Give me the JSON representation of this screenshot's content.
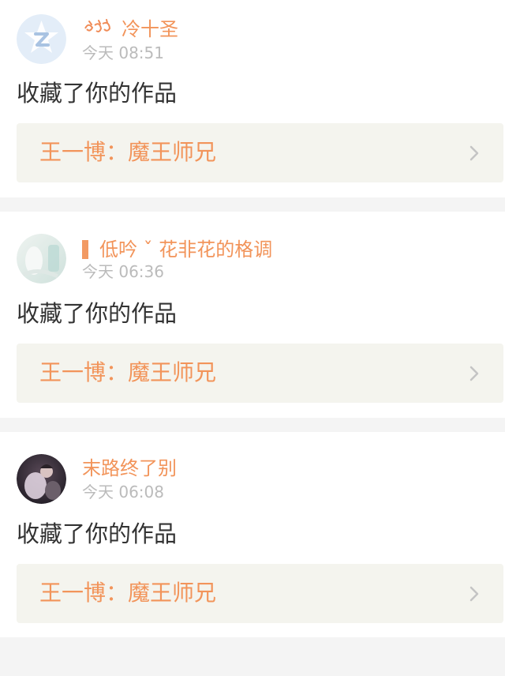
{
  "feed": {
    "items": [
      {
        "username": "冷十圣",
        "time": "今天 08:51",
        "action": "收藏了你的作品",
        "work_title": "王一博：魔王师兄"
      },
      {
        "username": "低吟 ˇ 花非花的格调",
        "time": "今天 06:36",
        "action": "收藏了你的作品",
        "work_title": "王一博：魔王师兄"
      },
      {
        "username": "末路终了别",
        "time": "今天 06:08",
        "action": "收藏了你的作品",
        "work_title": "王一博：魔王师兄"
      }
    ]
  },
  "icons": {
    "item_0_avatar": "default-avatar-icon",
    "item_0_badge": "swirl-badge-icon",
    "item_1_badge": "bar-badge-icon",
    "chevron": "chevron-right-icon"
  },
  "colors": {
    "accent": "#f2945a",
    "link_background": "#f4f4ee",
    "page_background": "#f4f4f4",
    "text_primary": "#333333",
    "text_secondary": "#bbbbbb",
    "chevron": "#c4c4c4"
  }
}
